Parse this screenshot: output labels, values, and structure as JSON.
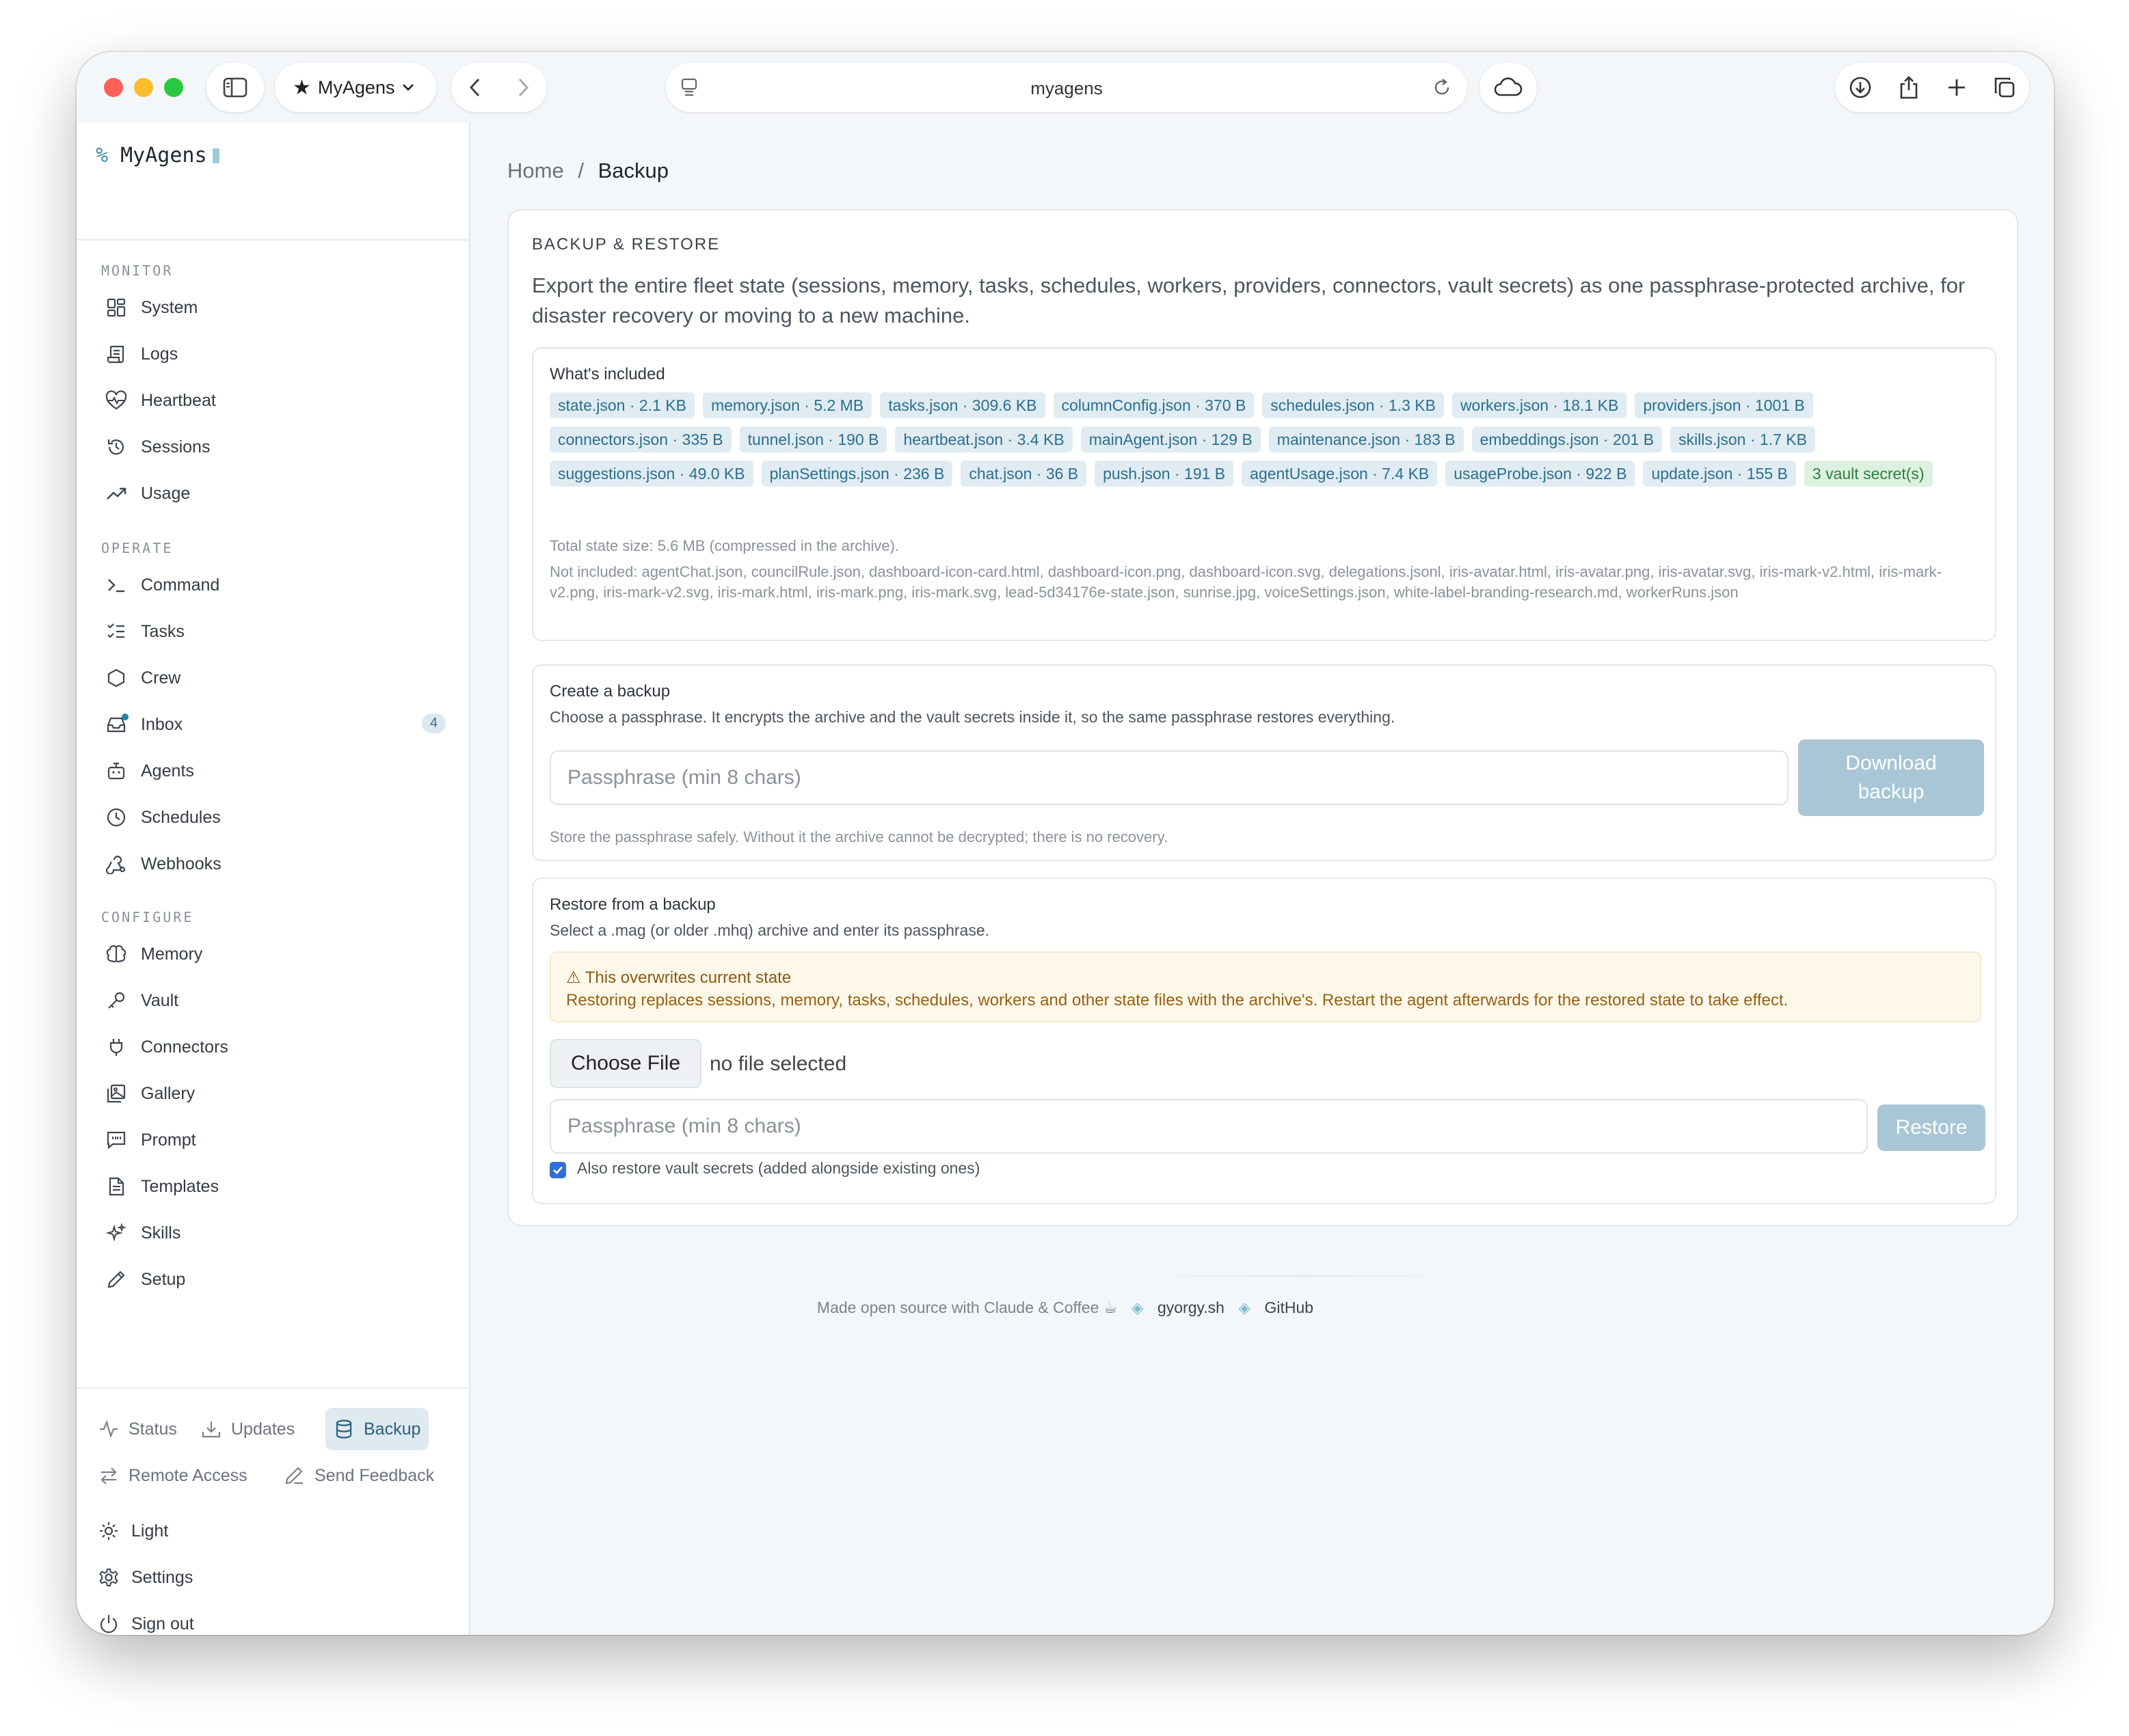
{
  "browser": {
    "tab_label": "MyAgens",
    "url": "myagens"
  },
  "brand": {
    "prefix": "%",
    "name": "MyAgens"
  },
  "sidebar": {
    "sections": [
      {
        "label": "MONITOR",
        "items": [
          {
            "label": "System",
            "icon": "dashboard-grid-icon"
          },
          {
            "label": "Logs",
            "icon": "logs-scroll-icon"
          },
          {
            "label": "Heartbeat",
            "icon": "heart-pulse-icon"
          },
          {
            "label": "Sessions",
            "icon": "history-icon"
          },
          {
            "label": "Usage",
            "icon": "trending-up-icon"
          }
        ]
      },
      {
        "label": "OPERATE",
        "items": [
          {
            "label": "Command",
            "icon": "terminal-icon"
          },
          {
            "label": "Tasks",
            "icon": "list-checks-icon"
          },
          {
            "label": "Crew",
            "icon": "hexagon-icon"
          },
          {
            "label": "Inbox",
            "icon": "inbox-icon",
            "count": "4"
          },
          {
            "label": "Agents",
            "icon": "bot-icon"
          },
          {
            "label": "Schedules",
            "icon": "clock-icon"
          },
          {
            "label": "Webhooks",
            "icon": "webhook-icon"
          }
        ]
      },
      {
        "label": "CONFIGURE",
        "items": [
          {
            "label": "Memory",
            "icon": "brain-icon"
          },
          {
            "label": "Vault",
            "icon": "key-icon"
          },
          {
            "label": "Connectors",
            "icon": "plug-icon"
          },
          {
            "label": "Gallery",
            "icon": "image-icon"
          },
          {
            "label": "Prompt",
            "icon": "message-quote-icon"
          },
          {
            "label": "Templates",
            "icon": "file-text-icon"
          },
          {
            "label": "Skills",
            "icon": "sparkles-icon"
          },
          {
            "label": "Setup",
            "icon": "pencil-icon"
          }
        ]
      }
    ],
    "bottom_tabs": [
      {
        "label": "Status",
        "icon": "activity-icon"
      },
      {
        "label": "Updates",
        "icon": "download-icon"
      },
      {
        "label": "Backup",
        "icon": "database-icon",
        "active": true
      },
      {
        "label": "Remote Access",
        "icon": "arrows-swap-icon"
      },
      {
        "label": "Send Feedback",
        "icon": "pen-icon"
      }
    ],
    "footer_items": [
      {
        "label": "Light",
        "icon": "sun-icon"
      },
      {
        "label": "Settings",
        "icon": "gear-icon"
      },
      {
        "label": "Sign out",
        "icon": "power-icon"
      }
    ]
  },
  "breadcrumb": {
    "home": "Home",
    "separator": "/",
    "current": "Backup"
  },
  "backup": {
    "title": "BACKUP & RESTORE",
    "description": "Export the entire fleet state (sessions, memory, tasks, schedules, workers, providers, connectors, vault secrets) as one passphrase-protected archive, for disaster recovery or moving to a new machine.",
    "included_heading": "What's included",
    "files": [
      "state.json · 2.1 KB",
      "memory.json · 5.2 MB",
      "tasks.json · 309.6 KB",
      "columnConfig.json · 370 B",
      "schedules.json · 1.3 KB",
      "workers.json · 18.1 KB",
      "providers.json · 1001 B",
      "connectors.json · 335 B",
      "tunnel.json · 190 B",
      "heartbeat.json · 3.4 KB",
      "mainAgent.json · 129 B",
      "maintenance.json · 183 B",
      "embeddings.json · 201 B",
      "skills.json · 1.7 KB",
      "suggestions.json · 49.0 KB",
      "planSettings.json · 236 B",
      "chat.json · 36 B",
      "push.json · 191 B",
      "agentUsage.json · 7.4 KB",
      "usageProbe.json · 922 B",
      "update.json · 155 B"
    ],
    "vault_chip": "3 vault secret(s)",
    "total_size": "Total state size: 5.6 MB (compressed in the archive).",
    "not_included": "Not included: agentChat.json, councilRule.json, dashboard-icon-card.html, dashboard-icon.png, dashboard-icon.svg, delegations.jsonl, iris-avatar.html, iris-avatar.png, iris-avatar.svg, iris-mark-v2.html, iris-mark-v2.png, iris-mark-v2.svg, iris-mark.html, iris-mark.png, iris-mark.svg, lead-5d34176e-state.json, sunrise.jpg, voiceSettings.json, white-label-branding-research.md, workerRuns.json",
    "create": {
      "heading": "Create a backup",
      "subtitle": "Choose a passphrase. It encrypts the archive and the vault secrets inside it, so the same passphrase restores everything.",
      "placeholder": "Passphrase (min 8 chars)",
      "button_line1": "Download",
      "button_line2": "backup",
      "note": "Store the passphrase safely. Without it the archive cannot be decrypted; there is no recovery."
    },
    "restore": {
      "heading": "Restore from a backup",
      "subtitle": "Select a .mag (or older .mhq) archive and enter its passphrase.",
      "warning_title": "⚠ This overwrites current state",
      "warning_text": "Restoring replaces sessions, memory, tasks, schedules, workers and other state files with the archive's. Restart the agent afterwards for the restored state to take effect.",
      "choose_file": "Choose File",
      "no_file": "no file selected",
      "placeholder": "Passphrase (min 8 chars)",
      "button": "Restore",
      "checkbox_label": "Also restore vault secrets (added alongside existing ones)",
      "checkbox_checked": true
    }
  },
  "footer": {
    "text": "Made open source with Claude & Coffee ☕",
    "sep": "◈",
    "link1": "gyorgy.sh",
    "link2": "GitHub"
  },
  "colors": {
    "accent": "#2a82a8",
    "button_disabled": "#a8c6d5",
    "chip_bg": "#e0ecf2",
    "warning_bg": "#fdf8ea"
  }
}
